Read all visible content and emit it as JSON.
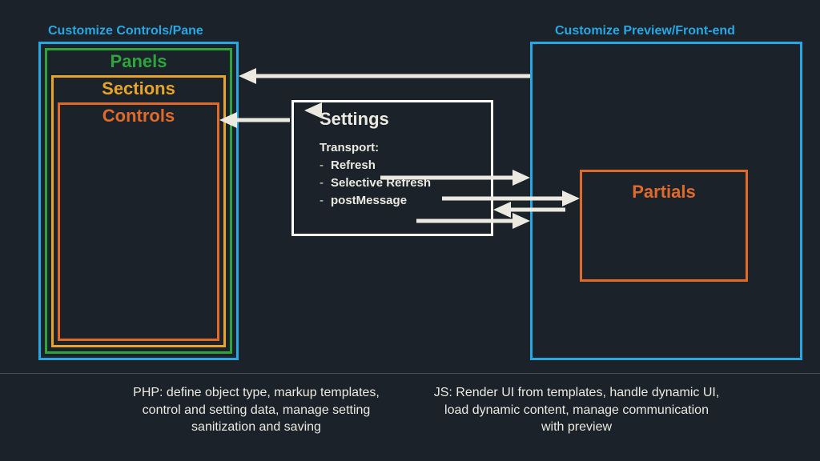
{
  "left": {
    "title": "Customize Controls/Pane",
    "panels": "Panels",
    "sections": "Sections",
    "controls": "Controls"
  },
  "settings": {
    "title": "Settings",
    "transport_label": "Transport:",
    "items": {
      "refresh": "Refresh",
      "selective": "Selective Refresh",
      "postmessage": "postMessage"
    }
  },
  "right": {
    "title": "Customize Preview/Front-end",
    "partials": "Partials"
  },
  "footer": {
    "php": "PHP: define object type, markup templates, control and setting data, manage setting sanitization and saving",
    "js": "JS: Render UI from templates, handle dynamic UI, load dynamic content, manage communication with preview"
  }
}
